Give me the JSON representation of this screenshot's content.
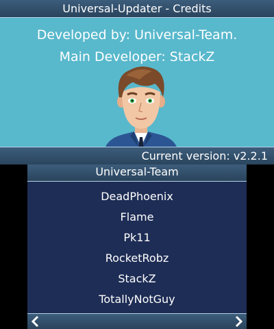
{
  "top": {
    "title": "Universal-Updater - Credits",
    "developed_by": "Developed by: Universal-Team.",
    "main_developer": "Main Developer: StackZ",
    "version": "Current version: v2.2.1"
  },
  "bottom": {
    "header": "Universal-Team",
    "members": [
      "DeadPhoenix",
      "Flame",
      "Pk11",
      "RocketRobz",
      "StackZ",
      "TotallyNotGuy"
    ],
    "nav": {
      "prev_icon": "chevron-left-icon",
      "next_icon": "chevron-right-icon"
    }
  },
  "colors": {
    "top_background": "#58b8cc",
    "bar": "#2f4b66",
    "bottom_background": "#1e2d55",
    "text": "#ffffff"
  }
}
